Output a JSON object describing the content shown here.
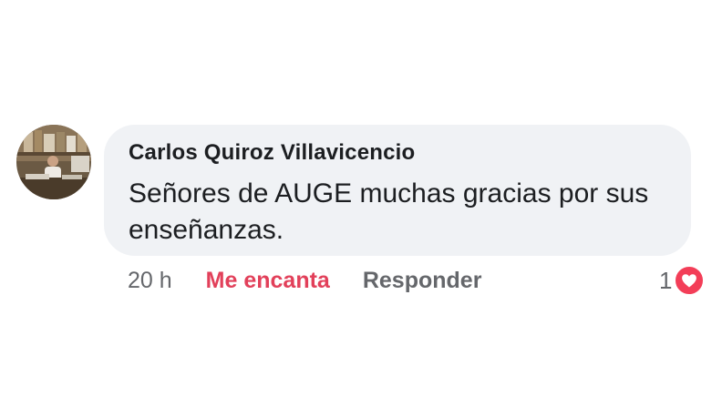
{
  "comment": {
    "author": "Carlos Quiroz Villavicencio",
    "text": "Señores de AUGE muchas gracias por sus enseñanzas.",
    "timestamp": "20 h",
    "actions": {
      "react_label": "Me encanta",
      "reply_label": "Responder"
    },
    "reactions": {
      "count": "1",
      "type_icon": "heart-icon"
    }
  },
  "colors": {
    "bubble_bg": "#f0f2f5",
    "reaction_active": "#e2405a",
    "heart_badge": "#f33e58",
    "muted_text": "#65676b"
  }
}
